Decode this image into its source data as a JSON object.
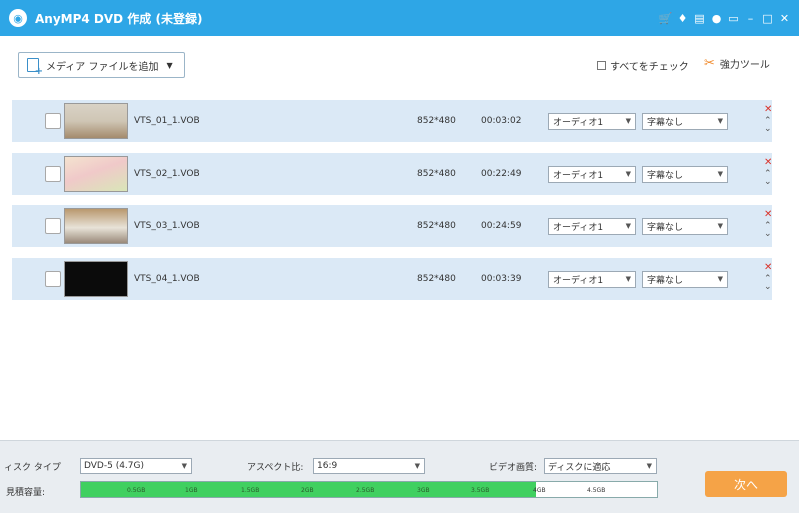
{
  "window": {
    "title": "AnyMP4 DVD 作成 (未登録)",
    "icons": [
      "cart-icon",
      "key-icon",
      "register-icon",
      "chat-icon",
      "feedback-icon",
      "minimize-icon",
      "maximize-icon",
      "close-icon"
    ]
  },
  "toolbar": {
    "add_media_label": "メディア ファイルを追加",
    "check_all_label": "すべてをチェック",
    "power_tools_label": "強力ツール"
  },
  "rows": [
    {
      "filename": "VTS_01_1.VOB",
      "resolution": "852*480",
      "duration": "00:03:02",
      "audio": "オーディオ1",
      "subtitle": "字幕なし"
    },
    {
      "filename": "VTS_02_1.VOB",
      "resolution": "852*480",
      "duration": "00:22:49",
      "audio": "オーディオ1",
      "subtitle": "字幕なし"
    },
    {
      "filename": "VTS_03_1.VOB",
      "resolution": "852*480",
      "duration": "00:24:59",
      "audio": "オーディオ1",
      "subtitle": "字幕なし"
    },
    {
      "filename": "VTS_04_1.VOB",
      "resolution": "852*480",
      "duration": "00:03:39",
      "audio": "オーディオ1",
      "subtitle": "字幕なし"
    }
  ],
  "bottom": {
    "disc_type_label": "ィスク タイプ",
    "disc_type_value": "DVD-5 (4.7G)",
    "aspect_label": "アスペクト比:",
    "aspect_value": "16:9",
    "quality_label": "ビデオ画質:",
    "quality_value": "ディスクに適応",
    "capacity_label": "見積容量:",
    "capacity_used_fraction": 0.79,
    "capacity_ticks": [
      "0.5GB",
      "1GB",
      "1.5GB",
      "2GB",
      "2.5GB",
      "3GB",
      "3.5GB",
      "4GB",
      "4.5GB"
    ],
    "next_label": "次へ"
  },
  "colors": {
    "titlebar": "#2ea6e6",
    "row_bg": "#dbe9f6",
    "capacity_fill": "#40d060",
    "next_button": "#f5a347",
    "delete": "#d9322a"
  }
}
